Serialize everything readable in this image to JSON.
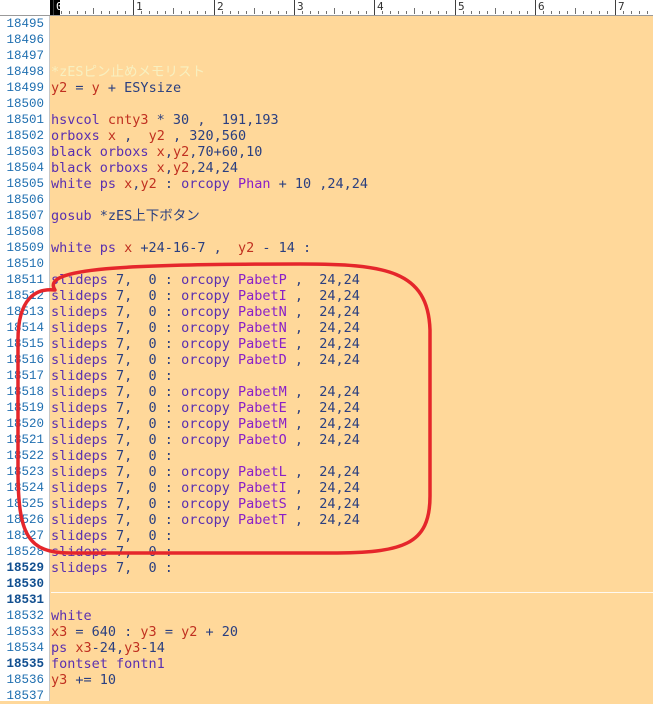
{
  "ruler": {
    "marks": [
      "0",
      "1",
      "2",
      "3",
      "4",
      "5",
      "6",
      "7"
    ]
  },
  "annotation": {
    "color": "#e5262b"
  },
  "colors": {
    "background": "#ffd89a",
    "line_numbers": "#1f6fb0",
    "keyword": "#5a2fb0",
    "variable": "#c03020",
    "resource": "#8a20c8"
  },
  "lines": [
    {
      "num": "18495",
      "bold": false,
      "tokens": []
    },
    {
      "num": "18496",
      "bold": false,
      "tokens": []
    },
    {
      "num": "18497",
      "bold": false,
      "tokens": []
    },
    {
      "num": "18498",
      "bold": false,
      "tokens": [
        {
          "t": "*zESピン止めメモリスト",
          "c": "lbl"
        }
      ]
    },
    {
      "num": "18499",
      "bold": false,
      "tokens": [
        {
          "t": "y2",
          "c": "var"
        },
        {
          "t": " = ",
          "c": "def"
        },
        {
          "t": "y",
          "c": "var"
        },
        {
          "t": " + ESYsize",
          "c": "def"
        }
      ]
    },
    {
      "num": "18500",
      "bold": false,
      "tokens": []
    },
    {
      "num": "18501",
      "bold": false,
      "tokens": [
        {
          "t": "hsvcol ",
          "c": "kw"
        },
        {
          "t": "cnty3",
          "c": "var"
        },
        {
          "t": " * 30 ,  191,193",
          "c": "def"
        }
      ]
    },
    {
      "num": "18502",
      "bold": false,
      "tokens": [
        {
          "t": "orboxs ",
          "c": "kw"
        },
        {
          "t": "x",
          "c": "var"
        },
        {
          "t": " ,  ",
          "c": "def"
        },
        {
          "t": "y2",
          "c": "var"
        },
        {
          "t": " , 320,560",
          "c": "def"
        }
      ]
    },
    {
      "num": "18503",
      "bold": false,
      "tokens": [
        {
          "t": "black orboxs ",
          "c": "kw"
        },
        {
          "t": "x",
          "c": "var"
        },
        {
          "t": ",",
          "c": "def"
        },
        {
          "t": "y2",
          "c": "var"
        },
        {
          "t": ",70+60,10",
          "c": "def"
        }
      ]
    },
    {
      "num": "18504",
      "bold": false,
      "tokens": [
        {
          "t": "black orboxs ",
          "c": "kw"
        },
        {
          "t": "x",
          "c": "var"
        },
        {
          "t": ",",
          "c": "def"
        },
        {
          "t": "y2",
          "c": "var"
        },
        {
          "t": ",24,24",
          "c": "def"
        }
      ]
    },
    {
      "num": "18505",
      "bold": false,
      "tokens": [
        {
          "t": "white ps ",
          "c": "kw"
        },
        {
          "t": "x",
          "c": "var"
        },
        {
          "t": ",",
          "c": "def"
        },
        {
          "t": "y2",
          "c": "var"
        },
        {
          "t": " : ",
          "c": "def"
        },
        {
          "t": "orcopy ",
          "c": "kw"
        },
        {
          "t": "Phan",
          "c": "res"
        },
        {
          "t": " + 10 ,24,24",
          "c": "def"
        }
      ]
    },
    {
      "num": "18506",
      "bold": false,
      "tokens": []
    },
    {
      "num": "18507",
      "bold": false,
      "tokens": [
        {
          "t": "gosub ",
          "c": "kw"
        },
        {
          "t": "*zES上下ボタン",
          "c": "def"
        }
      ]
    },
    {
      "num": "18508",
      "bold": false,
      "tokens": []
    },
    {
      "num": "18509",
      "bold": false,
      "tokens": [
        {
          "t": "white ps ",
          "c": "kw"
        },
        {
          "t": "x",
          "c": "var"
        },
        {
          "t": " +24-16-7 ,  ",
          "c": "def"
        },
        {
          "t": "y2",
          "c": "var"
        },
        {
          "t": " - 14 :",
          "c": "def"
        }
      ]
    },
    {
      "num": "18510",
      "bold": false,
      "tokens": []
    },
    {
      "num": "18511",
      "bold": false,
      "tokens": [
        {
          "t": "slideps ",
          "c": "kw"
        },
        {
          "t": "7,  0 : ",
          "c": "def"
        },
        {
          "t": "orcopy ",
          "c": "kw"
        },
        {
          "t": "PabetP",
          "c": "res"
        },
        {
          "t": " ,  24,24",
          "c": "def"
        }
      ]
    },
    {
      "num": "18512",
      "bold": false,
      "tokens": [
        {
          "t": "slideps ",
          "c": "kw"
        },
        {
          "t": "7,  0 : ",
          "c": "def"
        },
        {
          "t": "orcopy ",
          "c": "kw"
        },
        {
          "t": "PabetI",
          "c": "res"
        },
        {
          "t": " ,  24,24",
          "c": "def"
        }
      ]
    },
    {
      "num": "18513",
      "bold": false,
      "tokens": [
        {
          "t": "slideps ",
          "c": "kw"
        },
        {
          "t": "7,  0 : ",
          "c": "def"
        },
        {
          "t": "orcopy ",
          "c": "kw"
        },
        {
          "t": "PabetN",
          "c": "res"
        },
        {
          "t": " ,  24,24",
          "c": "def"
        }
      ]
    },
    {
      "num": "18514",
      "bold": false,
      "tokens": [
        {
          "t": "slideps ",
          "c": "kw"
        },
        {
          "t": "7,  0 : ",
          "c": "def"
        },
        {
          "t": "orcopy ",
          "c": "kw"
        },
        {
          "t": "PabetN",
          "c": "res"
        },
        {
          "t": " ,  24,24",
          "c": "def"
        }
      ]
    },
    {
      "num": "18515",
      "bold": false,
      "tokens": [
        {
          "t": "slideps ",
          "c": "kw"
        },
        {
          "t": "7,  0 : ",
          "c": "def"
        },
        {
          "t": "orcopy ",
          "c": "kw"
        },
        {
          "t": "PabetE",
          "c": "res"
        },
        {
          "t": " ,  24,24",
          "c": "def"
        }
      ]
    },
    {
      "num": "18516",
      "bold": false,
      "tokens": [
        {
          "t": "slideps ",
          "c": "kw"
        },
        {
          "t": "7,  0 : ",
          "c": "def"
        },
        {
          "t": "orcopy ",
          "c": "kw"
        },
        {
          "t": "PabetD",
          "c": "res"
        },
        {
          "t": " ,  24,24",
          "c": "def"
        }
      ]
    },
    {
      "num": "18517",
      "bold": false,
      "tokens": [
        {
          "t": "slideps ",
          "c": "kw"
        },
        {
          "t": "7,  0 :",
          "c": "def"
        }
      ]
    },
    {
      "num": "18518",
      "bold": false,
      "tokens": [
        {
          "t": "slideps ",
          "c": "kw"
        },
        {
          "t": "7,  0 : ",
          "c": "def"
        },
        {
          "t": "orcopy ",
          "c": "kw"
        },
        {
          "t": "PabetM",
          "c": "res"
        },
        {
          "t": " ,  24,24",
          "c": "def"
        }
      ]
    },
    {
      "num": "18519",
      "bold": false,
      "tokens": [
        {
          "t": "slideps ",
          "c": "kw"
        },
        {
          "t": "7,  0 : ",
          "c": "def"
        },
        {
          "t": "orcopy ",
          "c": "kw"
        },
        {
          "t": "PabetE",
          "c": "res"
        },
        {
          "t": " ,  24,24",
          "c": "def"
        }
      ]
    },
    {
      "num": "18520",
      "bold": false,
      "tokens": [
        {
          "t": "slideps ",
          "c": "kw"
        },
        {
          "t": "7,  0 : ",
          "c": "def"
        },
        {
          "t": "orcopy ",
          "c": "kw"
        },
        {
          "t": "PabetM",
          "c": "res"
        },
        {
          "t": " ,  24,24",
          "c": "def"
        }
      ]
    },
    {
      "num": "18521",
      "bold": false,
      "tokens": [
        {
          "t": "slideps ",
          "c": "kw"
        },
        {
          "t": "7,  0 : ",
          "c": "def"
        },
        {
          "t": "orcopy ",
          "c": "kw"
        },
        {
          "t": "PabetO",
          "c": "res"
        },
        {
          "t": " ,  24,24",
          "c": "def"
        }
      ]
    },
    {
      "num": "18522",
      "bold": false,
      "tokens": [
        {
          "t": "slideps ",
          "c": "kw"
        },
        {
          "t": "7,  0 :",
          "c": "def"
        }
      ]
    },
    {
      "num": "18523",
      "bold": false,
      "tokens": [
        {
          "t": "slideps ",
          "c": "kw"
        },
        {
          "t": "7,  0 : ",
          "c": "def"
        },
        {
          "t": "orcopy ",
          "c": "kw"
        },
        {
          "t": "PabetL",
          "c": "res"
        },
        {
          "t": " ,  24,24",
          "c": "def"
        }
      ]
    },
    {
      "num": "18524",
      "bold": false,
      "tokens": [
        {
          "t": "slideps ",
          "c": "kw"
        },
        {
          "t": "7,  0 : ",
          "c": "def"
        },
        {
          "t": "orcopy ",
          "c": "kw"
        },
        {
          "t": "PabetI",
          "c": "res"
        },
        {
          "t": " ,  24,24",
          "c": "def"
        }
      ]
    },
    {
      "num": "18525",
      "bold": false,
      "tokens": [
        {
          "t": "slideps ",
          "c": "kw"
        },
        {
          "t": "7,  0 : ",
          "c": "def"
        },
        {
          "t": "orcopy ",
          "c": "kw"
        },
        {
          "t": "PabetS",
          "c": "res"
        },
        {
          "t": " ,  24,24",
          "c": "def"
        }
      ]
    },
    {
      "num": "18526",
      "bold": false,
      "tokens": [
        {
          "t": "slideps ",
          "c": "kw"
        },
        {
          "t": "7,  0 : ",
          "c": "def"
        },
        {
          "t": "orcopy ",
          "c": "kw"
        },
        {
          "t": "PabetT",
          "c": "res"
        },
        {
          "t": " ,  24,24",
          "c": "def"
        }
      ]
    },
    {
      "num": "18527",
      "bold": false,
      "tokens": [
        {
          "t": "slideps ",
          "c": "kw"
        },
        {
          "t": "7,  0 :",
          "c": "def"
        }
      ]
    },
    {
      "num": "18528",
      "bold": false,
      "tokens": [
        {
          "t": "slideps ",
          "c": "kw"
        },
        {
          "t": "7,  0 :",
          "c": "def"
        }
      ]
    },
    {
      "num": "18529",
      "bold": true,
      "tokens": [
        {
          "t": "slideps ",
          "c": "kw"
        },
        {
          "t": "7,  0 :",
          "c": "def"
        }
      ]
    },
    {
      "num": "18530",
      "bold": true,
      "tokens": []
    },
    {
      "num": "18531",
      "bold": true,
      "tokens": []
    },
    {
      "num": "18532",
      "bold": false,
      "tokens": [
        {
          "t": "white",
          "c": "kw"
        }
      ]
    },
    {
      "num": "18533",
      "bold": false,
      "tokens": [
        {
          "t": "x3",
          "c": "var"
        },
        {
          "t": " = 640 : ",
          "c": "def"
        },
        {
          "t": "y3",
          "c": "var"
        },
        {
          "t": " = ",
          "c": "def"
        },
        {
          "t": "y2",
          "c": "var"
        },
        {
          "t": " + 20",
          "c": "def"
        }
      ]
    },
    {
      "num": "18534",
      "bold": false,
      "tokens": [
        {
          "t": "ps ",
          "c": "kw"
        },
        {
          "t": "x3",
          "c": "var"
        },
        {
          "t": "-24,",
          "c": "def"
        },
        {
          "t": "y3",
          "c": "var"
        },
        {
          "t": "-14",
          "c": "def"
        }
      ]
    },
    {
      "num": "18535",
      "bold": true,
      "tokens": [
        {
          "t": "fontset fontn1",
          "c": "kw"
        }
      ]
    },
    {
      "num": "18536",
      "bold": false,
      "tokens": [
        {
          "t": "y3",
          "c": "var"
        },
        {
          "t": " += 10",
          "c": "def"
        }
      ]
    },
    {
      "num": "18537",
      "bold": false,
      "tokens": []
    }
  ]
}
